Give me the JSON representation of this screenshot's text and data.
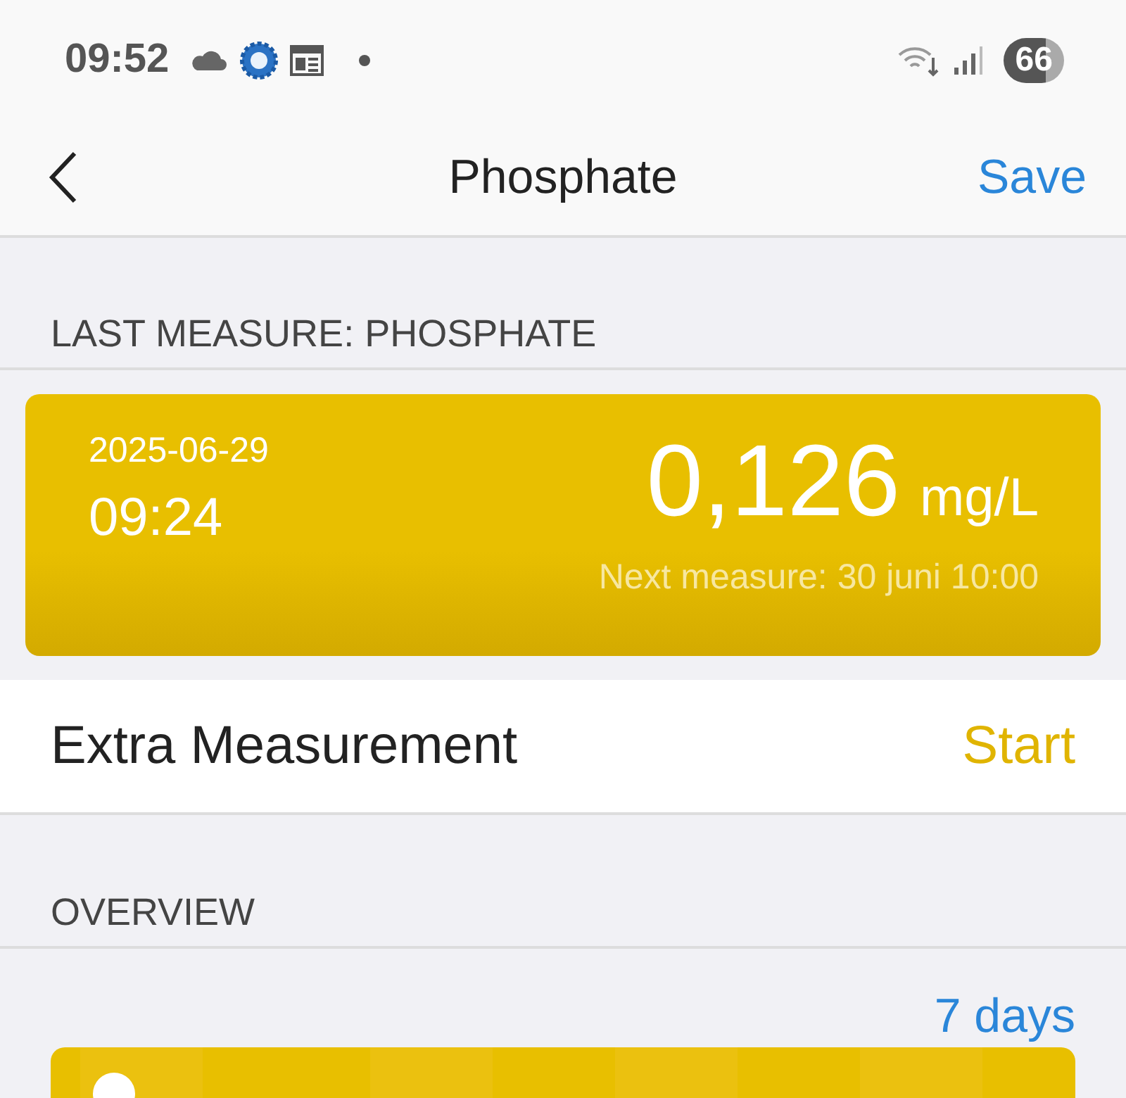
{
  "status_bar": {
    "time": "09:52",
    "battery": "66"
  },
  "nav": {
    "title": "Phosphate",
    "action": "Save"
  },
  "last_measure": {
    "header": "LAST MEASURE: PHOSPHATE",
    "date": "2025-06-29",
    "time": "09:24",
    "value": "0,126",
    "unit": "mg/L",
    "next": "Next measure: 30 juni 10:00"
  },
  "extra": {
    "label": "Extra Measurement",
    "action": "Start"
  },
  "overview": {
    "header": "OVERVIEW",
    "range": "7 days"
  }
}
